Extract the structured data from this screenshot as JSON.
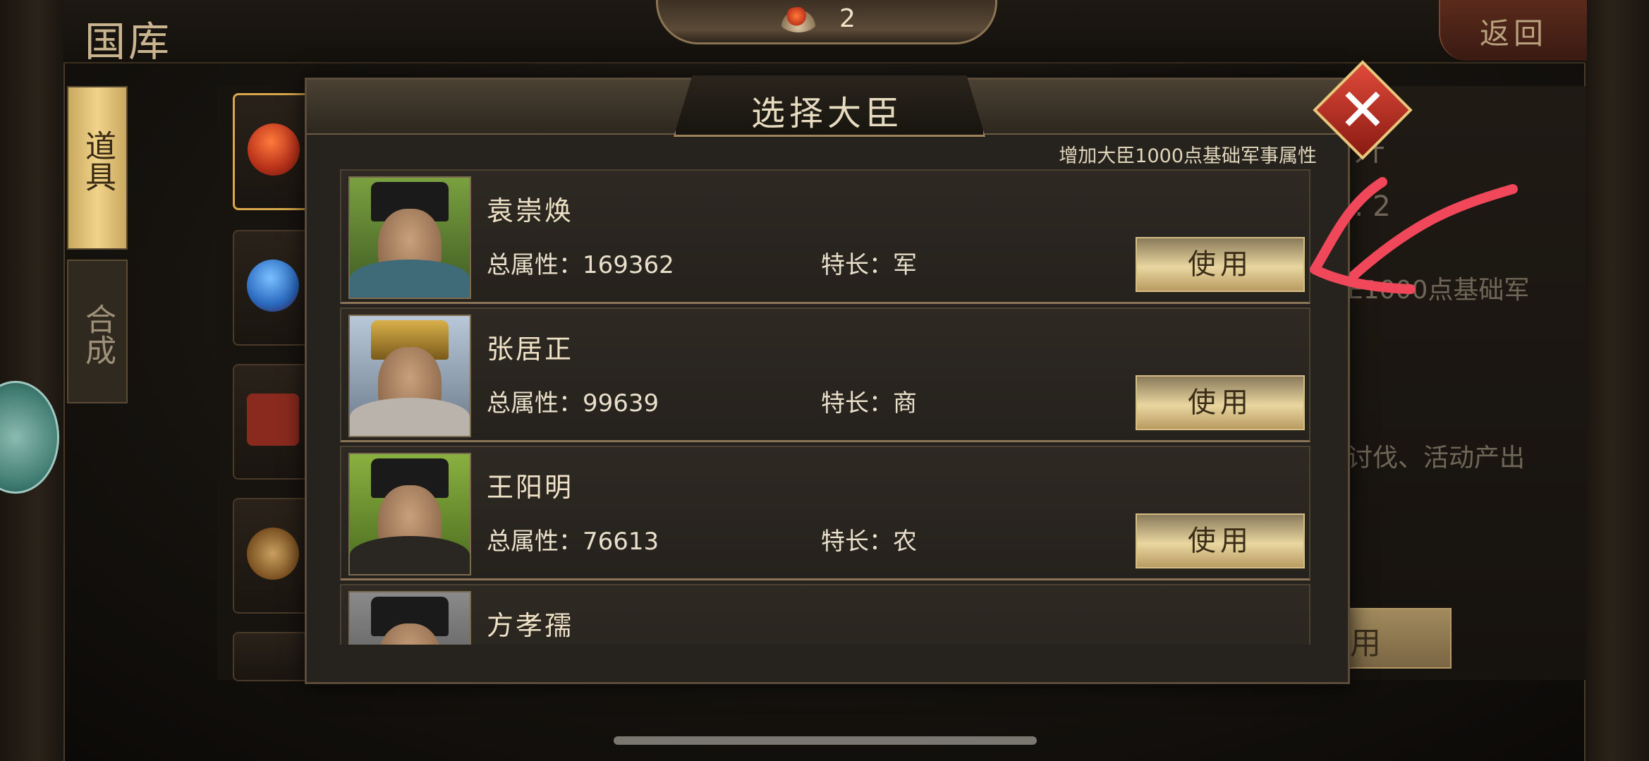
{
  "header": {
    "title": "国库",
    "resource_count": "2",
    "back_label": "返回"
  },
  "tabs": [
    {
      "label": "道具"
    },
    {
      "label": "合成"
    }
  ],
  "background_detail": {
    "partial_title": "升",
    "partial_count": ": 2",
    "partial_desc": "E1000点基础军",
    "partial_source": "讨伐、活动产出",
    "use_label": "使用"
  },
  "modal": {
    "title": "选择大臣",
    "hint": "增加大臣1000点基础军事属性",
    "ministers": [
      {
        "name": "袁崇焕",
        "total": "总属性：169362",
        "specialty": "特长：军",
        "use_label": "使用"
      },
      {
        "name": "张居正",
        "total": "总属性：99639",
        "specialty": "特长：商",
        "use_label": "使用"
      },
      {
        "name": "王阳明",
        "total": "总属性：76613",
        "specialty": "特长：农",
        "use_label": "使用"
      },
      {
        "name": "方孝孺",
        "total": "",
        "specialty": "",
        "use_label": ""
      }
    ]
  },
  "colors": {
    "accent_gold": "#e9d6a0",
    "annotation_red": "#f0485a",
    "close_red": "#e04a3a"
  }
}
